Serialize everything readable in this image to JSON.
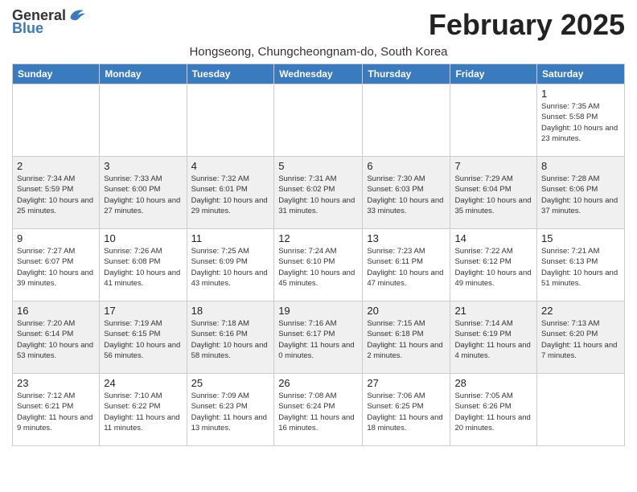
{
  "header": {
    "logo_general": "General",
    "logo_blue": "Blue",
    "month_title": "February 2025",
    "subtitle": "Hongseong, Chungcheongnam-do, South Korea"
  },
  "weekdays": [
    "Sunday",
    "Monday",
    "Tuesday",
    "Wednesday",
    "Thursday",
    "Friday",
    "Saturday"
  ],
  "weeks": [
    {
      "days": [
        {
          "num": "",
          "info": ""
        },
        {
          "num": "",
          "info": ""
        },
        {
          "num": "",
          "info": ""
        },
        {
          "num": "",
          "info": ""
        },
        {
          "num": "",
          "info": ""
        },
        {
          "num": "",
          "info": ""
        },
        {
          "num": "1",
          "info": "Sunrise: 7:35 AM\nSunset: 5:58 PM\nDaylight: 10 hours and 23 minutes."
        }
      ]
    },
    {
      "days": [
        {
          "num": "2",
          "info": "Sunrise: 7:34 AM\nSunset: 5:59 PM\nDaylight: 10 hours and 25 minutes."
        },
        {
          "num": "3",
          "info": "Sunrise: 7:33 AM\nSunset: 6:00 PM\nDaylight: 10 hours and 27 minutes."
        },
        {
          "num": "4",
          "info": "Sunrise: 7:32 AM\nSunset: 6:01 PM\nDaylight: 10 hours and 29 minutes."
        },
        {
          "num": "5",
          "info": "Sunrise: 7:31 AM\nSunset: 6:02 PM\nDaylight: 10 hours and 31 minutes."
        },
        {
          "num": "6",
          "info": "Sunrise: 7:30 AM\nSunset: 6:03 PM\nDaylight: 10 hours and 33 minutes."
        },
        {
          "num": "7",
          "info": "Sunrise: 7:29 AM\nSunset: 6:04 PM\nDaylight: 10 hours and 35 minutes."
        },
        {
          "num": "8",
          "info": "Sunrise: 7:28 AM\nSunset: 6:06 PM\nDaylight: 10 hours and 37 minutes."
        }
      ]
    },
    {
      "days": [
        {
          "num": "9",
          "info": "Sunrise: 7:27 AM\nSunset: 6:07 PM\nDaylight: 10 hours and 39 minutes."
        },
        {
          "num": "10",
          "info": "Sunrise: 7:26 AM\nSunset: 6:08 PM\nDaylight: 10 hours and 41 minutes."
        },
        {
          "num": "11",
          "info": "Sunrise: 7:25 AM\nSunset: 6:09 PM\nDaylight: 10 hours and 43 minutes."
        },
        {
          "num": "12",
          "info": "Sunrise: 7:24 AM\nSunset: 6:10 PM\nDaylight: 10 hours and 45 minutes."
        },
        {
          "num": "13",
          "info": "Sunrise: 7:23 AM\nSunset: 6:11 PM\nDaylight: 10 hours and 47 minutes."
        },
        {
          "num": "14",
          "info": "Sunrise: 7:22 AM\nSunset: 6:12 PM\nDaylight: 10 hours and 49 minutes."
        },
        {
          "num": "15",
          "info": "Sunrise: 7:21 AM\nSunset: 6:13 PM\nDaylight: 10 hours and 51 minutes."
        }
      ]
    },
    {
      "days": [
        {
          "num": "16",
          "info": "Sunrise: 7:20 AM\nSunset: 6:14 PM\nDaylight: 10 hours and 53 minutes."
        },
        {
          "num": "17",
          "info": "Sunrise: 7:19 AM\nSunset: 6:15 PM\nDaylight: 10 hours and 56 minutes."
        },
        {
          "num": "18",
          "info": "Sunrise: 7:18 AM\nSunset: 6:16 PM\nDaylight: 10 hours and 58 minutes."
        },
        {
          "num": "19",
          "info": "Sunrise: 7:16 AM\nSunset: 6:17 PM\nDaylight: 11 hours and 0 minutes."
        },
        {
          "num": "20",
          "info": "Sunrise: 7:15 AM\nSunset: 6:18 PM\nDaylight: 11 hours and 2 minutes."
        },
        {
          "num": "21",
          "info": "Sunrise: 7:14 AM\nSunset: 6:19 PM\nDaylight: 11 hours and 4 minutes."
        },
        {
          "num": "22",
          "info": "Sunrise: 7:13 AM\nSunset: 6:20 PM\nDaylight: 11 hours and 7 minutes."
        }
      ]
    },
    {
      "days": [
        {
          "num": "23",
          "info": "Sunrise: 7:12 AM\nSunset: 6:21 PM\nDaylight: 11 hours and 9 minutes."
        },
        {
          "num": "24",
          "info": "Sunrise: 7:10 AM\nSunset: 6:22 PM\nDaylight: 11 hours and 11 minutes."
        },
        {
          "num": "25",
          "info": "Sunrise: 7:09 AM\nSunset: 6:23 PM\nDaylight: 11 hours and 13 minutes."
        },
        {
          "num": "26",
          "info": "Sunrise: 7:08 AM\nSunset: 6:24 PM\nDaylight: 11 hours and 16 minutes."
        },
        {
          "num": "27",
          "info": "Sunrise: 7:06 AM\nSunset: 6:25 PM\nDaylight: 11 hours and 18 minutes."
        },
        {
          "num": "28",
          "info": "Sunrise: 7:05 AM\nSunset: 6:26 PM\nDaylight: 11 hours and 20 minutes."
        },
        {
          "num": "",
          "info": ""
        }
      ]
    }
  ]
}
